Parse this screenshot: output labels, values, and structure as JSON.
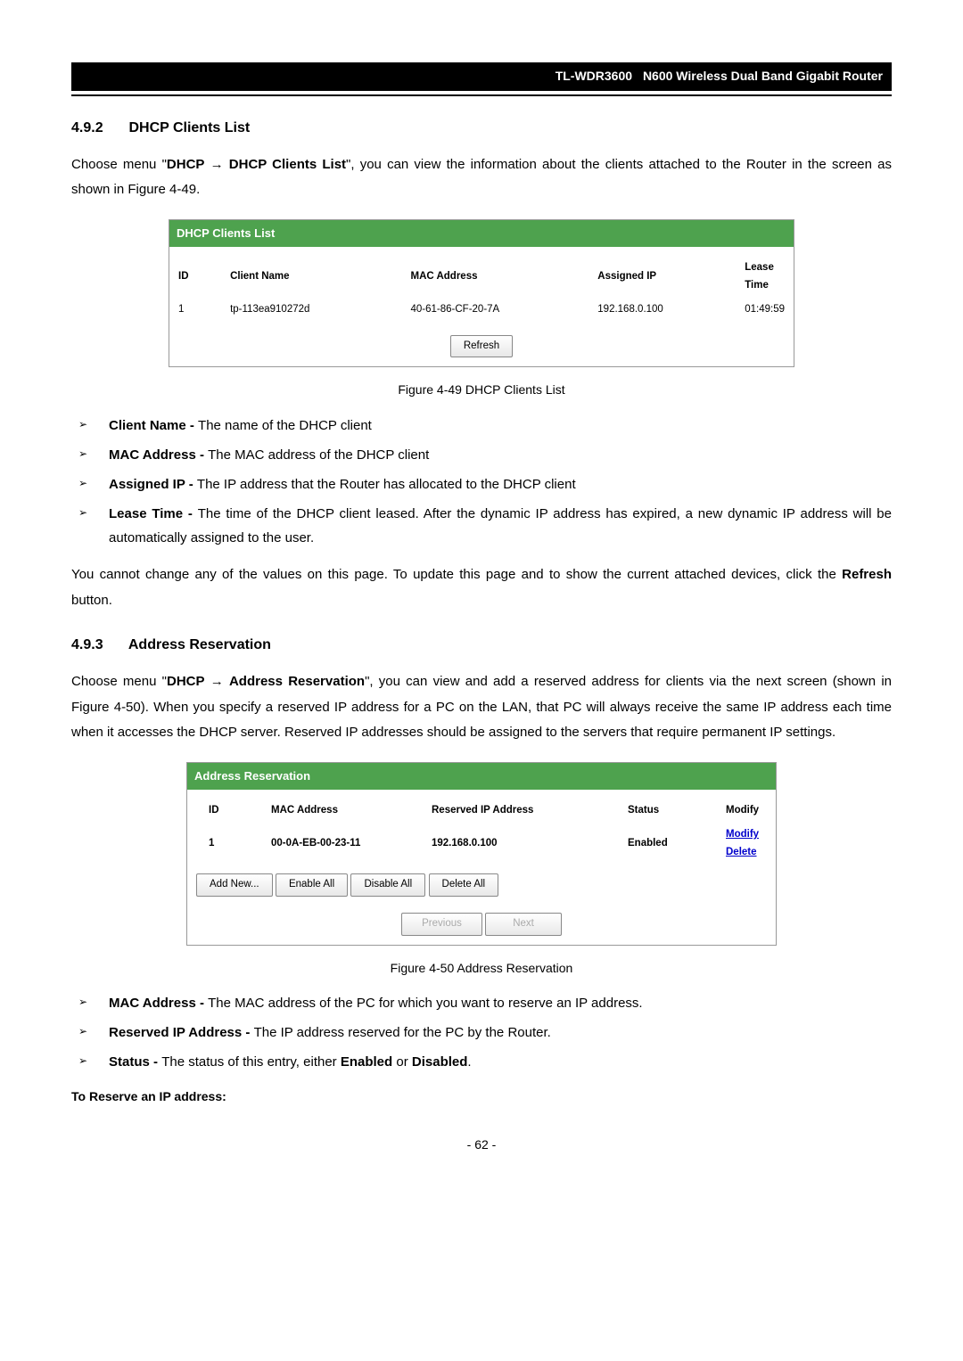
{
  "header": {
    "model": "TL-WDR3600",
    "title": "N600 Wireless Dual Band Gigabit Router"
  },
  "section1": {
    "number": "4.9.2",
    "title": "DHCP Clients List",
    "intro_prefix": "Choose menu \"",
    "intro_menu1": "DHCP",
    "intro_arrow": " → ",
    "intro_menu2": "DHCP Clients List",
    "intro_suffix": "\", you can view the information about the clients attached to the Router in the screen as shown in Figure 4-49."
  },
  "panel1": {
    "title": "DHCP Clients List",
    "headers": {
      "id": "ID",
      "client": "Client Name",
      "mac": "MAC Address",
      "ip": "Assigned IP",
      "lease": "Lease Time"
    },
    "row": {
      "id": "1",
      "client": "tp-113ea910272d",
      "mac": "40-61-86-CF-20-7A",
      "ip": "192.168.0.100",
      "lease": "01:49:59"
    },
    "refresh": "Refresh"
  },
  "caption1": "Figure 4-49 DHCP Clients List",
  "bullets1": {
    "b1_label": "Client Name - ",
    "b1_text": "The name of the DHCP client",
    "b2_label": "MAC Address - ",
    "b2_text": "The MAC address of the DHCP client",
    "b3_label": "Assigned IP - ",
    "b3_text": "The IP address that the Router has allocated to the DHCP client",
    "b4_label": "Lease Time - ",
    "b4_text": "The time of the DHCP client leased. After the dynamic IP address has expired, a new dynamic IP address will be automatically assigned to the user."
  },
  "para1_prefix": "You cannot change any of the values on this page. To update this page and to show the current attached devices, click the ",
  "para1_bold": "Refresh",
  "para1_suffix": " button.",
  "section2": {
    "number": "4.9.3",
    "title": "Address Reservation",
    "intro_prefix": "Choose menu \"",
    "intro_menu1": "DHCP",
    "intro_arrow": " → ",
    "intro_menu2": "Address Reservation",
    "intro_suffix": "\", you can view and add a reserved address for clients via the next screen (shown in Figure 4-50). When you specify a reserved IP address for a PC on the LAN, that PC will always receive the same IP address each time when it accesses the DHCP server. Reserved IP addresses should be assigned to the servers that require permanent IP settings."
  },
  "panel2": {
    "title": "Address Reservation",
    "headers": {
      "id": "ID",
      "mac": "MAC Address",
      "resip": "Reserved IP Address",
      "status": "Status",
      "modify": "Modify"
    },
    "row": {
      "id": "1",
      "mac": "00-0A-EB-00-23-11",
      "resip": "192.168.0.100",
      "status": "Enabled",
      "modify": "Modify",
      "delete": "Delete"
    },
    "buttons": {
      "addnew": "Add New...",
      "enableall": "Enable All",
      "disableall": "Disable All",
      "deleteall": "Delete All",
      "previous": "Previous",
      "next": "Next"
    }
  },
  "caption2": "Figure 4-50 Address Reservation",
  "bullets2": {
    "b1_label": "MAC Address - ",
    "b1_text": "The MAC address of the PC for which you want to reserve an IP address.",
    "b2_label": "Reserved IP Address - ",
    "b2_text": "The IP address reserved for the PC by the Router.",
    "b3_label": "Status - ",
    "b3_text_pre": "The status of this entry, either ",
    "b3_enabled": "Enabled",
    "b3_or": " or ",
    "b3_disabled": "Disabled",
    "b3_dot": "."
  },
  "reserve_heading": "To Reserve an IP address:",
  "page_number": "- 62 -"
}
